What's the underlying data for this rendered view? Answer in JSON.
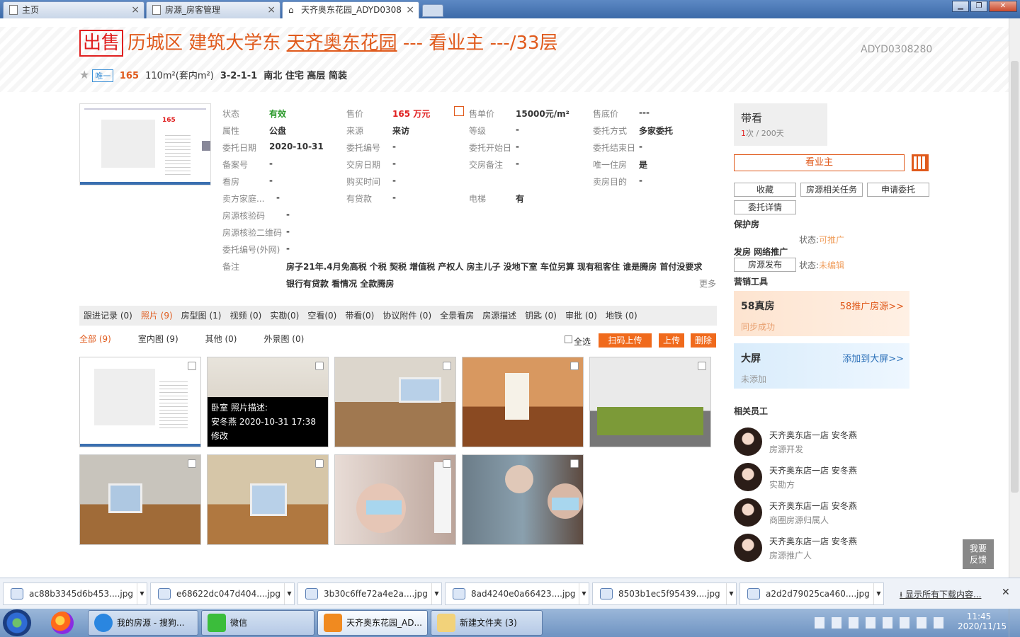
{
  "browser": {
    "tabs": [
      {
        "label": "主页"
      },
      {
        "label": "房源_房客管理"
      },
      {
        "label": "天齐奥东花园_ADYD0308"
      }
    ]
  },
  "listing": {
    "sale_badge": "出售",
    "district": "历城区",
    "area": "建筑大学东",
    "estate": "天齐奥东花园",
    "dash1": "---",
    "view_owner": "看业主",
    "floor": "---/33层",
    "code": "ADYD0308280",
    "unique": "唯一",
    "price": "165",
    "size": "110m²(套内m²)",
    "layout": "3-2-1-1",
    "orient": "南北",
    "use": "住宅",
    "level": "高层",
    "deco": "简装"
  },
  "thumb_text": {
    "price": "165"
  },
  "fields": {
    "status_l": "状态",
    "status_v": "有效",
    "price_l": "售价",
    "price_v": "165 万元",
    "unit_l": "售单价",
    "unit_v": "15000元/m²",
    "floor_l": "售底价",
    "floor_v": "---",
    "attr_l": "属性",
    "attr_v": "公盘",
    "src_l": "来源",
    "src_v": "来访",
    "grade_l": "等级",
    "grade_v": "-",
    "mode_l": "委托方式",
    "mode_v": "多家委托",
    "date_l": "委托日期",
    "date_v": "2020-10-31",
    "no_l": "委托编号",
    "no_v": "-",
    "start_l": "委托开始日",
    "start_v": "-",
    "end_l": "委托结束日",
    "end_v": "-",
    "rec_l": "备案号",
    "rec_v": "-",
    "deal_l": "交房日期",
    "deal_v": "-",
    "dnote_l": "交房备注",
    "dnote_v": "-",
    "only_l": "唯一住房",
    "only_v": "是",
    "see_l": "看房",
    "see_v": "-",
    "buy_l": "购买时间",
    "buy_v": "-",
    "purpose_l": "卖房目的",
    "purpose_v": "-",
    "family_l": "卖方家庭...",
    "family_v": "-",
    "loan_l": "有贷款",
    "loan_v": "-",
    "lift_l": "电梯",
    "lift_v": "有",
    "verify_l": "房源核验码",
    "verify_v": "-",
    "qr_l": "房源核验二维码",
    "qr_v": "-",
    "ext_l": "委托编号(外网)",
    "ext_v": "-",
    "note_l": "备注",
    "note_v1": "房子21年.4月免高税 个税 契税 增值税 产权人 房主儿子 没地下室 车位另算 现有租客住 谁是腾房 首付没要求",
    "note_v2": "银行有贷款 看情况 全款腾房",
    "more": "更多"
  },
  "side": {
    "visit_title": "带看",
    "visit_count": "1",
    "visit_rest": "次 / 200天",
    "owner_btn": "看业主",
    "fav": "收藏",
    "task": "房源相关任务",
    "apply": "申请委托",
    "detail": "委托详情",
    "protect": "保护房",
    "state_l": "状态:",
    "state_v": "可推广",
    "publish": "发房 网络推广",
    "publish_btn": "房源发布",
    "pub_state_l": "状态:",
    "pub_state_v": "未编辑",
    "tools": "营销工具",
    "card1_t": "58真房",
    "card1_link": "58推广房源>>",
    "card1_s": "同步成功",
    "card2_t": "大屏",
    "card2_link": "添加到大屏>>",
    "card2_s": "未添加",
    "staff_title": "相关员工"
  },
  "staff": [
    {
      "name": "天齐奥东店一店 安冬燕",
      "role": "房源开发"
    },
    {
      "name": "天齐奥东店一店 安冬燕",
      "role": "实勘方"
    },
    {
      "name": "天齐奥东店一店 安冬燕",
      "role": "商圈房源归属人"
    },
    {
      "name": "天齐奥东店一店 安冬燕",
      "role": "房源推广人"
    }
  ],
  "tabs": [
    "跟进记录 (0)",
    "照片 (9)",
    "房型图 (1)",
    "视频 (0)",
    "实勘(0)",
    "空看(0)",
    "带看(0)",
    "协议附件 (0)",
    "全景看房",
    "房源描述",
    "钥匙 (0)",
    "审批 (0)",
    "地铁 (0)"
  ],
  "subtabs": {
    "all": "全部 (9)",
    "indoor": "室内图 (9)",
    "other": "其他 (0)",
    "outdoor": "外景图 (0)",
    "selectall": "全选",
    "scan": "扫码上传",
    "upload": "上传",
    "delete": "删除"
  },
  "overlay": {
    "line1": "卧室   照片描述:",
    "line2": "安冬燕 2020-10-31 17:38",
    "line3": "修改"
  },
  "feedback": "我要\n反馈",
  "downloads": [
    {
      "name": "ac88b3345d6b453....jpg"
    },
    {
      "name": "e68622dc047d404....jpg"
    },
    {
      "name": "3b30c6ffe72a4e2a....jpg"
    },
    {
      "name": "8ad4240e0a66423....jpg"
    },
    {
      "name": "8503b1ec5f95439....jpg"
    },
    {
      "name": "a2d2d79025ca460....jpg"
    }
  ],
  "show_all": "显示所有下载内容...",
  "taskbar": {
    "items": [
      "我的房源 - 搜狗...",
      "微信",
      "天齐奥东花园_AD...",
      "新建文件夹 (3)"
    ],
    "time": "11:45",
    "date": "2020/11/15"
  }
}
